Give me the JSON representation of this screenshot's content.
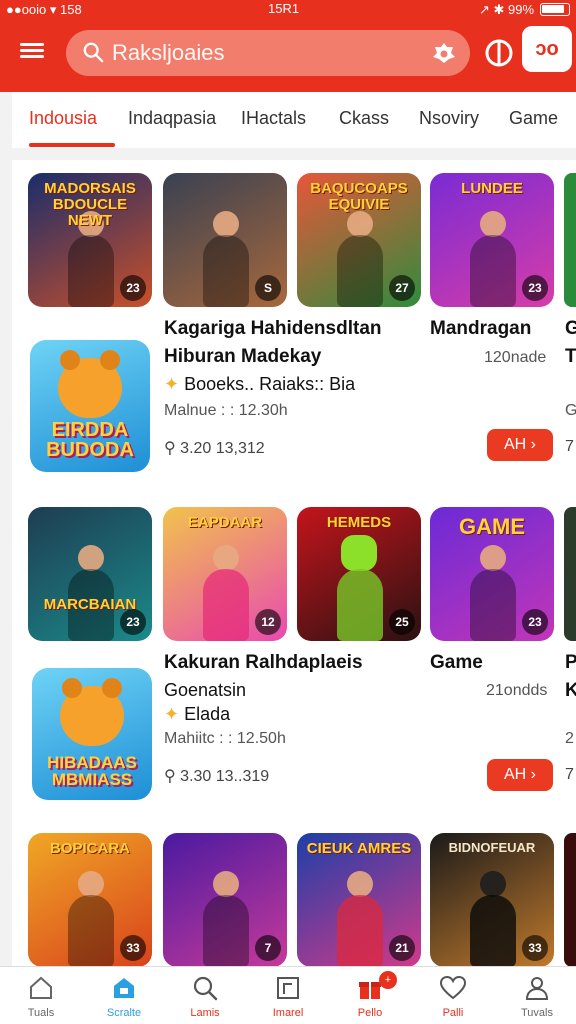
{
  "status": {
    "left": "●●ooio ▾ 158",
    "time": "15R1",
    "right": "↗ ✱ 99%"
  },
  "search": {
    "placeholder": "Raksljoaies"
  },
  "header": {
    "box_label": "ɔo"
  },
  "tabs": [
    "Indousia",
    "Indaqpasia",
    "IHactals",
    "Ckass",
    "Nsoviry",
    "Game"
  ],
  "sections": [
    {
      "thumbs": [
        {
          "title": "MADORSAIS BDOUCLE NEWT",
          "badge": "23",
          "colors": [
            "#1a2d6b",
            "#c9502a"
          ]
        },
        {
          "title": "",
          "badge": "S",
          "colors": [
            "#394152",
            "#a8683c"
          ]
        },
        {
          "title": "BAQUCOAPS EQUIVIE",
          "badge": "27",
          "colors": [
            "#e7563a",
            "#2f8c3c"
          ]
        },
        {
          "title": "LUNDEE",
          "badge": "23",
          "colors": [
            "#7a2bd4",
            "#d73da8"
          ]
        }
      ],
      "mascot": "EIRDDA BUDODA",
      "title1": "Kagariga Hahidensdltan",
      "title2": "Hiburan Madekay",
      "sub": "Booeks..  Raiaks::  Bia",
      "meta": "Malnue : : 12.30h",
      "stats": "3.20   13,312",
      "side_title": "Mandragan",
      "side_count": "120nade",
      "cta": "AH ›",
      "edge_title": "G",
      "edge_sub": "T",
      "edge_meta": "G",
      "edge_stats": "7"
    },
    {
      "thumbs": [
        {
          "title": "MARCBAIAN",
          "badge": "23",
          "colors": [
            "#1e3d52",
            "#1b8a8a"
          ]
        },
        {
          "title": "EAPDAAR",
          "badge": "12",
          "colors": [
            "#f1c34c",
            "#e84ab0"
          ]
        },
        {
          "title": "HEMEDS",
          "badge": "25",
          "colors": [
            "#c4141c",
            "#2a1212"
          ]
        },
        {
          "title": "GAME",
          "badge": "23",
          "colors": [
            "#6b2ad6",
            "#c236b8"
          ]
        }
      ],
      "mascot": "HIBADAAS MBMIASS",
      "title1": "Kakuran Ralhdaplaeis",
      "title2": "Goenatsin",
      "sub": "Elada",
      "meta": "Mahiitc : : 12.50h",
      "stats": "3.30   13..319",
      "side_title": "Game",
      "side_count": "21ondds",
      "cta": "AH ›",
      "edge_title": "P",
      "edge_sub": "K",
      "edge_meta": "2",
      "edge_stats": "7"
    },
    {
      "thumbs": [
        {
          "title": "BOPICARA",
          "badge": "33",
          "colors": [
            "#f0a726",
            "#d9421c"
          ]
        },
        {
          "title": "",
          "badge": "7",
          "colors": [
            "#4a1aa0",
            "#c63a9a"
          ]
        },
        {
          "title": "CIEUK AMRES",
          "badge": "21",
          "colors": [
            "#1d3fa8",
            "#d13a8a"
          ]
        },
        {
          "title": "BIDNOFEUAR",
          "badge": "33",
          "colors": [
            "#1b1a1a",
            "#c07a2c"
          ]
        }
      ]
    }
  ],
  "nav": [
    {
      "label": "Tuals",
      "icon": "home-icon"
    },
    {
      "label": "Scralte",
      "icon": "store-icon"
    },
    {
      "label": "Lamis",
      "icon": "search-icon"
    },
    {
      "label": "Imarel",
      "icon": "frame-icon"
    },
    {
      "label": "Pello",
      "icon": "gift-icon",
      "badge": "+"
    },
    {
      "label": "Palli",
      "icon": "heart-icon"
    },
    {
      "label": "Tuvals",
      "icon": "profile-icon"
    }
  ],
  "colors": {
    "brand": "#e8301e",
    "active_nav": "#2aa0e0"
  }
}
